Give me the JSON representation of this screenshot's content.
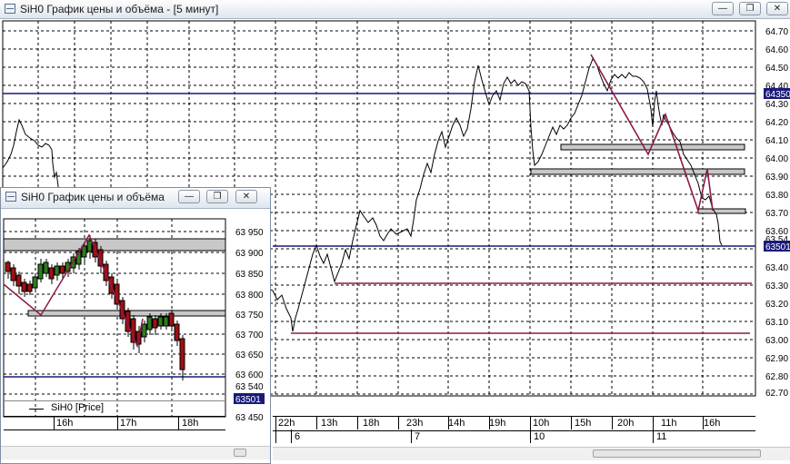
{
  "main_window": {
    "title": "SiH0 График цены и объёма - [5 минут]",
    "price_axis": [
      "64.70",
      "64.60",
      "64.50",
      "64.40",
      "64.30",
      "64.20",
      "64.10",
      "64.00",
      "63.90",
      "63.80",
      "63.70",
      "63.60",
      "63.50",
      "63.40",
      "63.30",
      "63.20",
      "63.10",
      "63.00",
      "62.90",
      "62.80",
      "62.70"
    ],
    "price_marker_top": "64350",
    "price_marker_bottom": "63501",
    "price_marker_small": "63.54",
    "time_labels": [
      "22h",
      "13h",
      "18h",
      "23h",
      "14h",
      "19h",
      "10h",
      "15h",
      "20h",
      "11h",
      "16h"
    ],
    "date_labels": [
      "6",
      "7",
      "10",
      "11"
    ],
    "colors": {
      "level_line": "#1a1a7a",
      "trend_line": "#8b1a4a",
      "zone_fill": "#c8c8c8"
    }
  },
  "inset_window": {
    "title": "SiH0 График цены и объёма",
    "price_axis": [
      "63 950",
      "63 900",
      "63 850",
      "63 800",
      "63 750",
      "63 700",
      "63 650",
      "63 600",
      "63 540",
      "63 450"
    ],
    "price_marker": "63501",
    "legend": "SiH0 [Price]",
    "time_labels": [
      "16h",
      "17h",
      "18h"
    ],
    "colors": {
      "bull": "#2e7d1e",
      "bear": "#a01010"
    }
  }
}
